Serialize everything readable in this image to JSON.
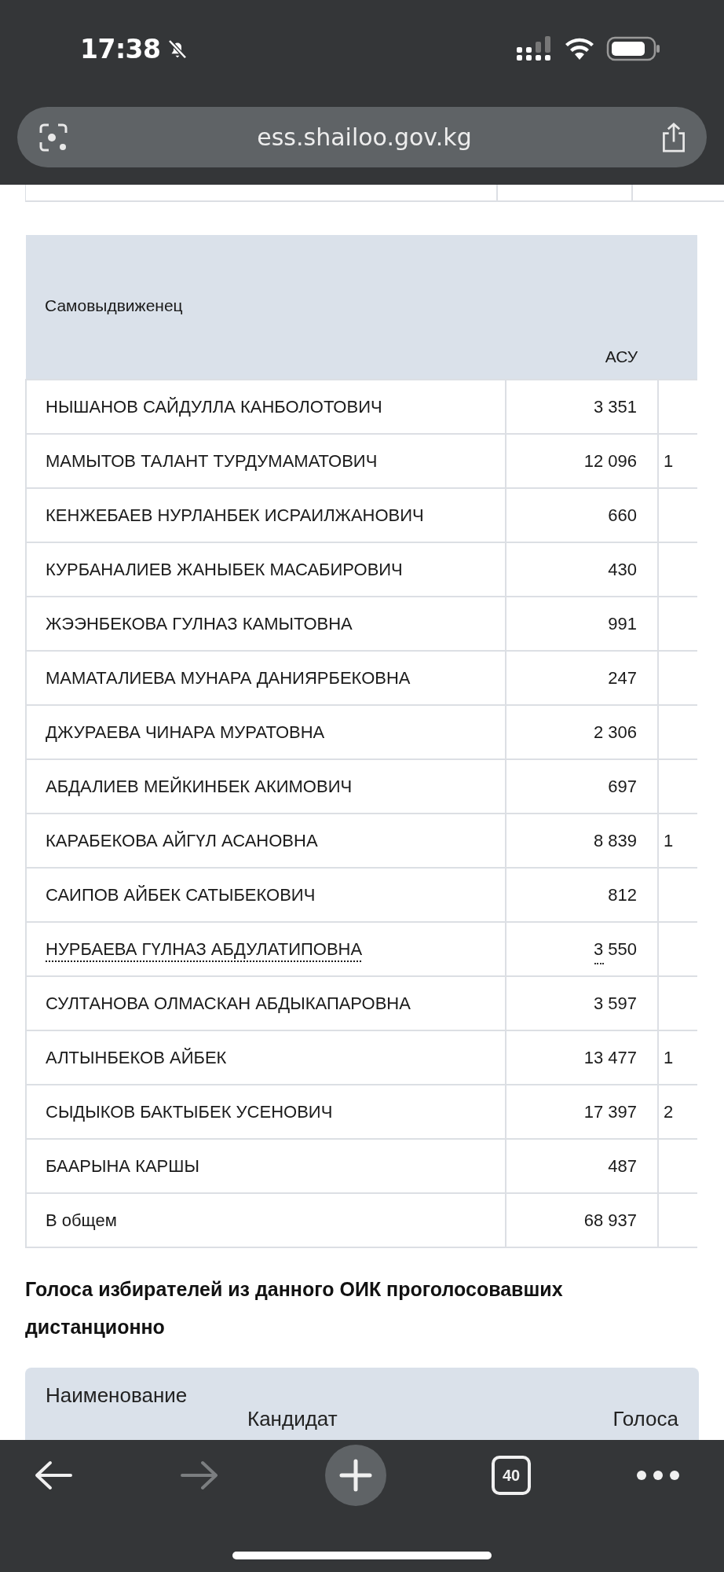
{
  "status_bar": {
    "time": "17:38"
  },
  "address_bar": {
    "url": "ess.shailoo.gov.kg"
  },
  "results_table": {
    "columns": [
      {
        "label": "Самовыдвиженец"
      },
      {
        "label": "АСУ"
      }
    ],
    "rows": [
      {
        "name": "НЫШАНОВ САЙДУЛЛА КАНБОЛОТОВИЧ",
        "votes": "3 351",
        "marked": false
      },
      {
        "name": "МАМЫТОВ ТАЛАНТ ТУРДУМАМАТОВИЧ",
        "votes": "12 096",
        "column_3": "1",
        "marked": false
      },
      {
        "name": "КЕНЖЕБАЕВ НУРЛАНБЕК ИСРАИЛЖАНОВИЧ",
        "votes": "660",
        "marked": false
      },
      {
        "name": "КУРБАНАЛИЕВ ЖАНЫБЕК МАСАБИРОВИЧ",
        "votes": "430",
        "marked": false
      },
      {
        "name": "ЖЭЭНБЕКОВА ГУЛНАЗ КАМЫТОВНА",
        "votes": "991",
        "marked": false
      },
      {
        "name": "МАМАТАЛИЕВА МУНАРА ДАНИЯРБЕКОВНА",
        "votes": "247",
        "marked": false
      },
      {
        "name": "ДЖУРАЕВА ЧИНАРА МУРАТОВНА",
        "votes": "2 306",
        "marked": false
      },
      {
        "name": "АБДАЛИЕВ МЕЙКИНБЕК АКИМОВИЧ",
        "votes": "697",
        "marked": false
      },
      {
        "name": "КАРАБЕКОВА АЙГҮЛ АСАНОВНА",
        "votes": "8 839",
        "column_3": "1",
        "marked": false
      },
      {
        "name": "САИПОВ АЙБЕК САТЫБЕКОВИЧ",
        "votes": "812",
        "marked": false
      },
      {
        "name": "НУРБАЕВА ГҮЛНАЗ АБДУЛАТИПОВНА",
        "votes": "3 550",
        "marked": true
      },
      {
        "name": "СУЛТАНОВА ОЛМАСКАН АБДЫКАПАРОВНА",
        "votes": "3 597",
        "marked": false
      },
      {
        "name": "АЛТЫНБЕКОВ АЙБЕК",
        "votes": "13 477",
        "column_3": "1",
        "marked": false
      },
      {
        "name": "СЫДЫКОВ БАКТЫБЕК УСЕНОВИЧ",
        "votes": "17 397",
        "column_3": "2",
        "marked": false
      },
      {
        "name": "БААРЫНА КАРШЫ",
        "votes": "487",
        "marked": false
      },
      {
        "name": "В общем",
        "votes": "68 937",
        "marked": false
      }
    ]
  },
  "remote_section": {
    "title": "Голоса избирателей из данного ОИК проголосовавших дистанционно",
    "columns": [
      "Наименование",
      "Кандидат",
      "Голоса"
    ]
  },
  "toolbar": {
    "tab_count": "40"
  }
}
